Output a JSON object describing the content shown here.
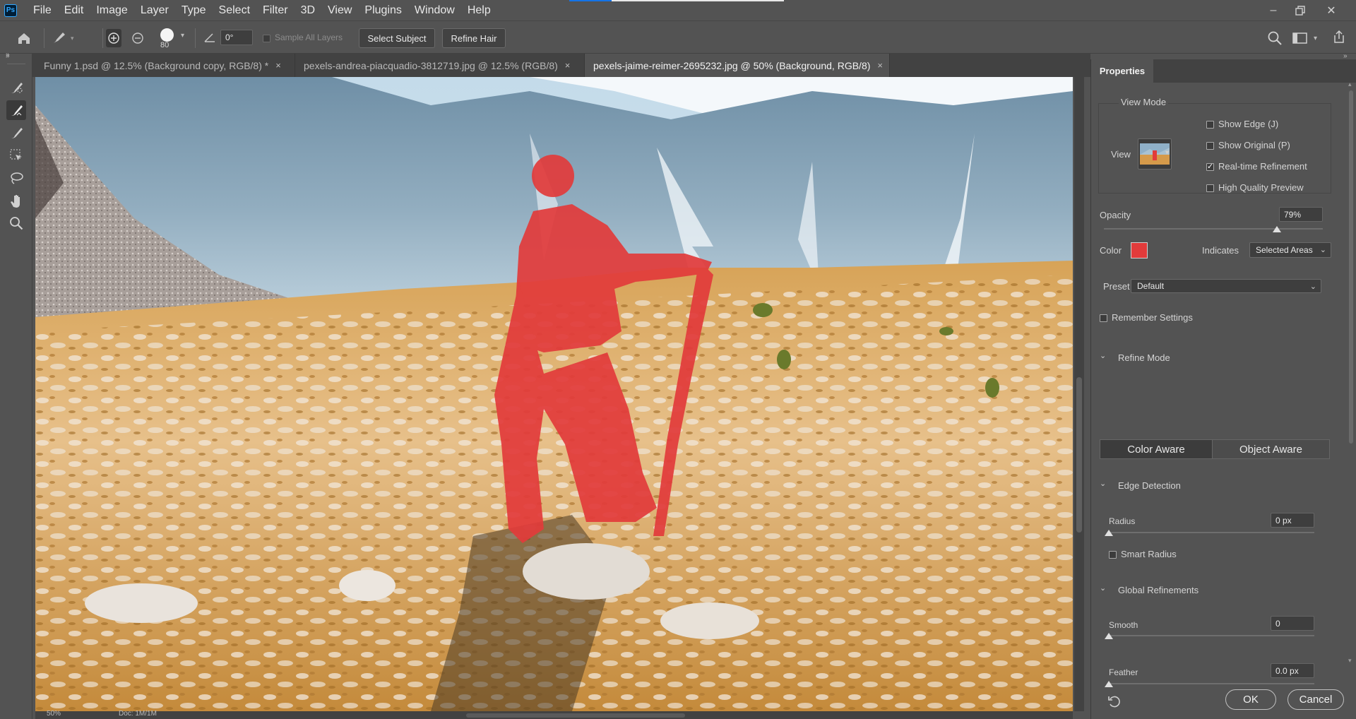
{
  "app": {
    "logo_text": "Ps"
  },
  "menu": [
    "File",
    "Edit",
    "Image",
    "Layer",
    "Type",
    "Select",
    "Filter",
    "3D",
    "View",
    "Plugins",
    "Window",
    "Help"
  ],
  "options": {
    "brush_size": "80",
    "angle_value": "0°",
    "sample_all_layers_label": "Sample All Layers",
    "select_subject_label": "Select Subject",
    "refine_hair_label": "Refine Hair"
  },
  "tabs": [
    {
      "label": "Funny 1.psd @ 12.5% (Background copy, RGB/8) *",
      "close": "×"
    },
    {
      "label": "pexels-andrea-piacquadio-3812719.jpg @ 12.5% (RGB/8)",
      "close": "×"
    },
    {
      "label": "pexels-jaime-reimer-2695232.jpg @ 50% (Background, RGB/8)",
      "close": "×"
    }
  ],
  "status": {
    "zoom": "50%",
    "doc": "Doc: 1M/1M"
  },
  "properties": {
    "title": "Properties",
    "view_mode_heading": "View Mode",
    "view_label": "View",
    "show_edge": {
      "label": "Show Edge (J)",
      "checked": false
    },
    "show_original": {
      "label": "Show Original (P)",
      "checked": false
    },
    "realtime_refinement": {
      "label": "Real-time Refinement",
      "checked": true
    },
    "high_quality_preview": {
      "label": "High Quality Preview",
      "checked": false
    },
    "opacity_label": "Opacity",
    "opacity_value": "79%",
    "opacity_level": 0.79,
    "color_label": "Color",
    "overlay_color": "#e23b3b",
    "indicates_label": "Indicates",
    "indicates_value": "Selected Areas",
    "preset_label": "Preset",
    "preset_value": "Default",
    "remember_settings": {
      "label": "Remember Settings",
      "checked": false
    },
    "refine_mode_heading": "Refine Mode",
    "color_aware_label": "Color Aware",
    "object_aware_label": "Object Aware",
    "edge_detection_heading": "Edge Detection",
    "radius_label": "Radius",
    "radius_value": "0 px",
    "smart_radius": {
      "label": "Smart Radius",
      "checked": false
    },
    "global_refinements_heading": "Global Refinements",
    "smooth_label": "Smooth",
    "smooth_value": "0",
    "feather_label": "Feather",
    "feather_value": "0.0 px",
    "ok_label": "OK",
    "cancel_label": "Cancel"
  },
  "colors": {
    "accent": "#1473e6",
    "overlay": "#e23b3b",
    "panel_bg": "#535353",
    "dark_bg": "#424242"
  },
  "icons": [
    "home-icon",
    "brush-preset-icon",
    "add-to-selection-icon",
    "subtract-from-selection-icon",
    "angle-icon",
    "search-icon",
    "workspace-icon",
    "share-icon",
    "quick-selection-tool-icon",
    "refine-edge-brush-icon",
    "brush-tool-icon",
    "object-selection-tool-icon",
    "lasso-tool-icon",
    "hand-tool-icon",
    "zoom-tool-icon",
    "reset-icon"
  ]
}
